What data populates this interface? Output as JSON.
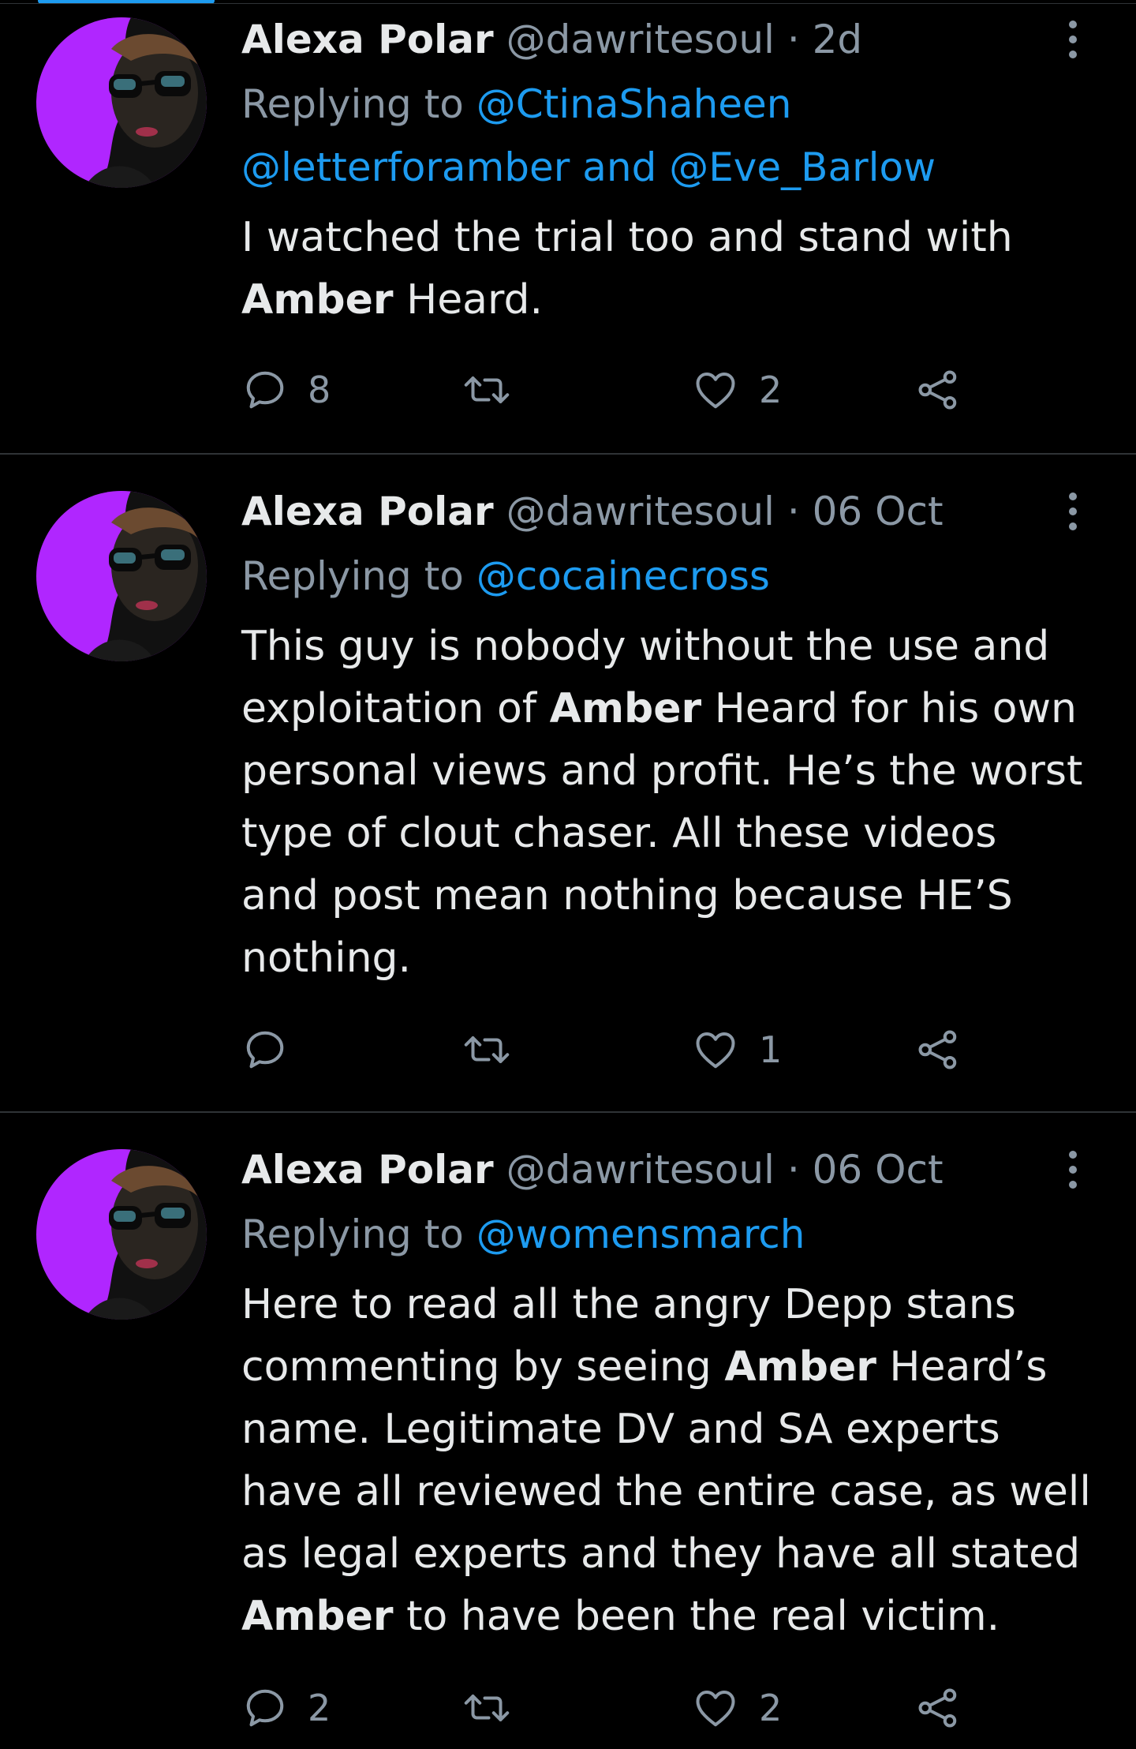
{
  "colors": {
    "background": "#000000",
    "text_primary": "#e7e9ea",
    "text_secondary": "#8b98a5",
    "link": "#1d9bf0",
    "divider": "#2f3336",
    "avatar_accent": "#b026ff"
  },
  "icons": {
    "reply": "reply-icon",
    "retweet": "retweet-icon",
    "like": "heart-icon",
    "share": "share-icon",
    "more": "more-icon"
  },
  "tweets": [
    {
      "name": "Alexa Polar",
      "handle": "@dawritesoul",
      "sep": "·",
      "time": "2d",
      "replying_prefix": "Replying to ",
      "mention_1": "@CtinaShaheen",
      "mention_2": "@letterforamber",
      "and_1": " and ",
      "mention_3": "@Eve_Barlow",
      "text_1": "I watched the trial too and stand with",
      "bold_1": "Amber",
      "text_2": " Heard.",
      "reply_count": "8",
      "retweet_count": "",
      "like_count": "2"
    },
    {
      "name": "Alexa Polar",
      "handle": "@dawritesoul",
      "sep": "·",
      "time": "06 Oct",
      "replying_prefix": "Replying to ",
      "mention_1": "@cocainecross",
      "text_1": "This guy is nobody without the use and",
      "text_2": "exploitation of ",
      "bold_1": "Amber",
      "text_3": " Heard for his own",
      "text_4": "personal views and profit. He’s the worst",
      "text_5": "type of clout chaser. All these videos",
      "text_6": "and post mean nothing because HE’S",
      "text_7": "nothing.",
      "reply_count": "",
      "retweet_count": "",
      "like_count": "1"
    },
    {
      "name": "Alexa Polar",
      "handle": "@dawritesoul",
      "sep": "·",
      "time": "06 Oct",
      "replying_prefix": "Replying to ",
      "mention_1": "@womensmarch",
      "text_1": "Here to read all the angry Depp stans",
      "text_2": "commenting by seeing ",
      "bold_1": "Amber",
      "text_3": " Heard’s",
      "text_4": "name. Legitimate DV and SA experts",
      "text_5": "have all reviewed the entire case, as well",
      "text_6": "as legal experts and they have all stated",
      "bold_2": "Amber",
      "text_7": " to have been the real victim.",
      "reply_count": "2",
      "retweet_count": "",
      "like_count": "2"
    }
  ]
}
